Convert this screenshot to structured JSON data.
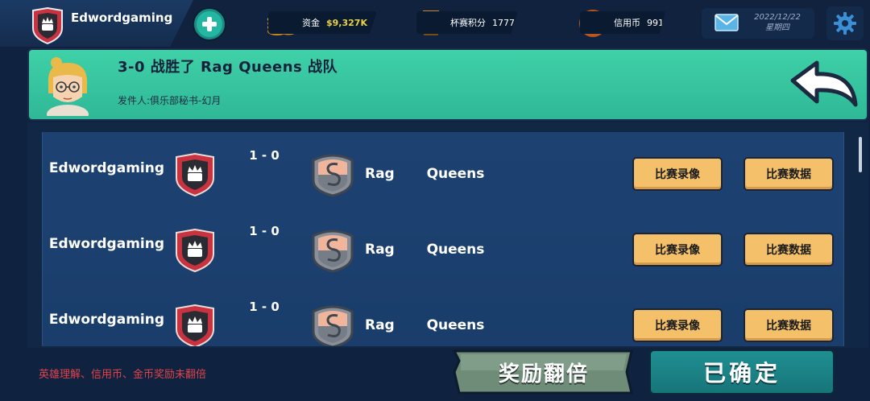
{
  "top_bar": {
    "team_name": "Edwordgaming",
    "funds_label": "资金",
    "funds_value": "$9,327K",
    "cup_label": "杯赛积分",
    "cup_value": "1777",
    "credit_label": "信用币",
    "credit_value": "991",
    "date": "2022/12/22",
    "weekday": "星期四",
    "icons": [
      "add-icon",
      "coins-icon",
      "trophy-icon",
      "credit-coin-icon",
      "mail-icon",
      "gear-icon"
    ]
  },
  "banner": {
    "title": "3-0 战胜了 Rag Queens 战队",
    "sender": "发件人:俱乐部秘书-幻月"
  },
  "matches": [
    {
      "home": "Edwordgaming",
      "score": "1 - 0",
      "away": "Rag  Queens",
      "replay_label": "比赛录像",
      "stats_label": "比赛数据"
    },
    {
      "home": "Edwordgaming",
      "score": "1 - 0",
      "away": "Rag  Queens",
      "replay_label": "比赛录像",
      "stats_label": "比赛数据"
    },
    {
      "home": "Edwordgaming",
      "score": "1 - 0",
      "away": "Rag  Queens",
      "replay_label": "比赛录像",
      "stats_label": "比赛数据"
    }
  ],
  "footer": {
    "note": "英雄理解、信用币、金币奖励未翻倍",
    "double_reward_label": "奖励翻倍",
    "confirm_label": "已确定"
  },
  "colors": {
    "banner": "#3fd1a8",
    "match_button": "#f4c06a",
    "confirm_button": "#1f8f92",
    "note_red": "#e0434a",
    "crest_red": "#c9323f"
  }
}
